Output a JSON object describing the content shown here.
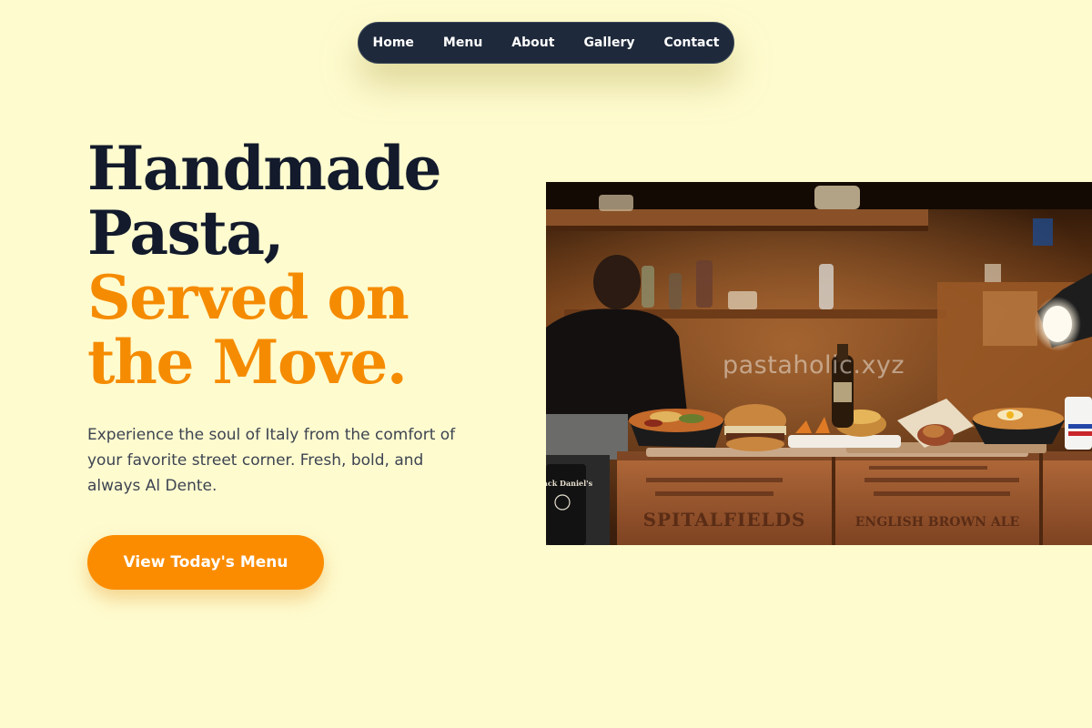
{
  "nav": {
    "items": [
      "Home",
      "Menu",
      "About",
      "Gallery",
      "Contact"
    ]
  },
  "hero": {
    "title_line1": "Handmade",
    "title_line2": "Pasta,",
    "title_line3": "Served on",
    "title_line4": "the Move.",
    "description": "Experience the soul of Italy from the comfort of your favorite street corner. Fresh, bold, and always Al Dente.",
    "cta_label": "View Today's Menu"
  },
  "image": {
    "watermark": "pastaholic.xyz",
    "crate_text_1": "SPITALFIELDS",
    "crate_text_2": "ENGLISH BROWN ALE",
    "bottle_label": "Jack Daniel's"
  },
  "colors": {
    "background": "#fefbcf",
    "nav_bg": "#1e293b",
    "heading_dark": "#121a2b",
    "accent": "#f58b00",
    "cta_bg": "#fb8c00"
  }
}
